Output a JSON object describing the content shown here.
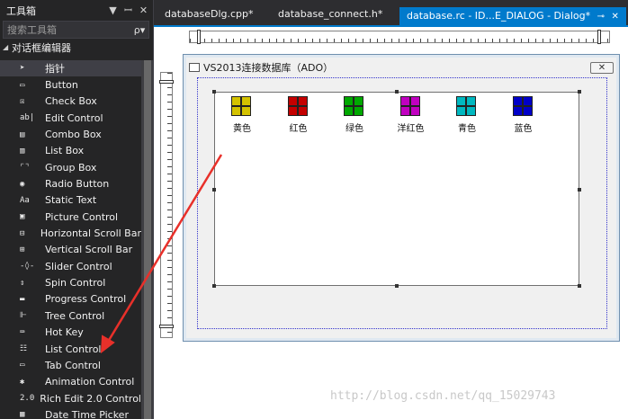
{
  "toolbox": {
    "title": "工具箱",
    "controls": {
      "dropdown": "▼",
      "pin": "ꟷ",
      "close": "✕"
    },
    "search_placeholder": "搜索工具箱",
    "search_icon": "ρ▾",
    "group": "对话框编辑器",
    "items": [
      {
        "label": "指针",
        "icon": "pointer-icon",
        "glyph": "➤",
        "selected": true
      },
      {
        "label": "Button",
        "icon": "button-icon",
        "glyph": "▭"
      },
      {
        "label": "Check Box",
        "icon": "checkbox-icon",
        "glyph": "☒"
      },
      {
        "label": "Edit Control",
        "icon": "edit-control-icon",
        "glyph": "ab|"
      },
      {
        "label": "Combo Box",
        "icon": "combo-box-icon",
        "glyph": "▤"
      },
      {
        "label": "List Box",
        "icon": "list-box-icon",
        "glyph": "▥"
      },
      {
        "label": "Group Box",
        "icon": "group-box-icon",
        "glyph": "⌜⌝"
      },
      {
        "label": "Radio Button",
        "icon": "radio-button-icon",
        "glyph": "◉"
      },
      {
        "label": "Static Text",
        "icon": "static-text-icon",
        "glyph": "Aa"
      },
      {
        "label": "Picture Control",
        "icon": "picture-control-icon",
        "glyph": "▣"
      },
      {
        "label": "Horizontal Scroll Bar",
        "icon": "hscroll-icon",
        "glyph": "⊟"
      },
      {
        "label": "Vertical Scroll Bar",
        "icon": "vscroll-icon",
        "glyph": "⊞"
      },
      {
        "label": "Slider Control",
        "icon": "slider-icon",
        "glyph": "-◊-"
      },
      {
        "label": "Spin Control",
        "icon": "spin-icon",
        "glyph": "⇕"
      },
      {
        "label": "Progress Control",
        "icon": "progress-icon",
        "glyph": "▬"
      },
      {
        "label": "Tree Control",
        "icon": "tree-icon",
        "glyph": "⊩"
      },
      {
        "label": "Hot Key",
        "icon": "hotkey-icon",
        "glyph": "⌨"
      },
      {
        "label": "List Control",
        "icon": "list-control-icon",
        "glyph": "☷"
      },
      {
        "label": "Tab Control",
        "icon": "tab-control-icon",
        "glyph": "▭"
      },
      {
        "label": "Animation Control",
        "icon": "animation-icon",
        "glyph": "✱"
      },
      {
        "label": "Rich Edit 2.0 Control",
        "icon": "rich-edit-icon",
        "glyph": "2.0"
      },
      {
        "label": "Date Time Picker",
        "icon": "date-time-icon",
        "glyph": "▦"
      }
    ]
  },
  "tabs": [
    {
      "label": "databaseDlg.cpp*"
    },
    {
      "label": "database_connect.h*"
    },
    {
      "label": "database.rc - ID...E_DIALOG - Dialog*",
      "active": true,
      "pin": "⊸",
      "close": "✕"
    }
  ],
  "dialog": {
    "title": "VS2013连接数据库（ADO）",
    "close": "✕",
    "list_items": [
      {
        "label": "黄色",
        "color": "#d4c200"
      },
      {
        "label": "红色",
        "color": "#c40000"
      },
      {
        "label": "绿色",
        "color": "#00a800"
      },
      {
        "label": "洋红色",
        "color": "#c000c0"
      },
      {
        "label": "青色",
        "color": "#00b8c0"
      },
      {
        "label": "蓝色",
        "color": "#0000c8"
      }
    ]
  },
  "watermark": "http://blog.csdn.net/qq_15029743"
}
